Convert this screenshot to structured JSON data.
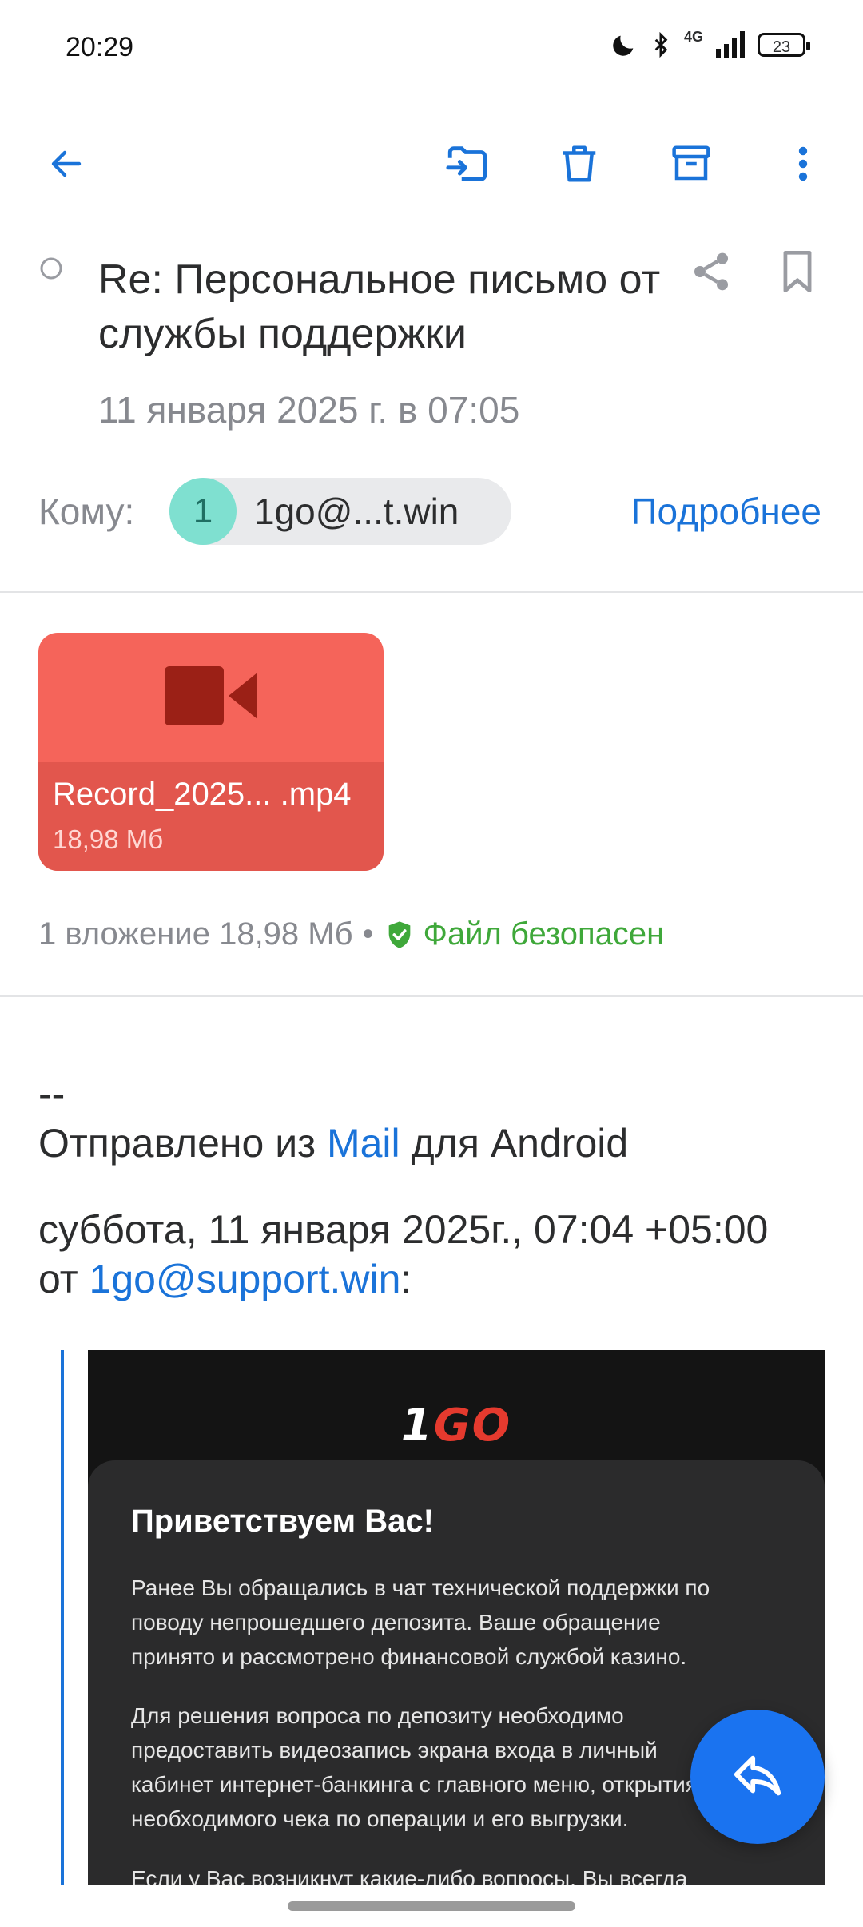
{
  "status_bar": {
    "time": "20:29",
    "battery": "23",
    "network": "4G"
  },
  "toolbar": {
    "back_icon": "arrow-left-icon",
    "move_icon": "folder-move-icon",
    "delete_icon": "trash-icon",
    "archive_icon": "archive-icon",
    "more_icon": "more-vertical-icon"
  },
  "email": {
    "subject": "Re: Персональное письмо от службы поддержки",
    "date": "11 января 2025 г. в 07:05",
    "to_label": "Кому:",
    "recipient_initial": "1",
    "recipient": "1go@...t.win",
    "details_link": "Подробнее"
  },
  "attachment": {
    "name": "Record_2025... .mp4",
    "size": "18,98 Мб",
    "summary": "1 вложение 18,98 Мб",
    "bullet": "•",
    "safe_label": "Файл безопасен"
  },
  "body": {
    "dashes": "--",
    "sent_from_prefix": "Отправлено из ",
    "sent_from_app": "Mail",
    "sent_from_suffix": " для Android",
    "quote_header_line1": "суббота, 11 января 2025г., 07:04 +05:00",
    "quote_header_from": "от ",
    "quote_header_email": "1go@support.win",
    "quote_header_colon": ":"
  },
  "quoted": {
    "logo_one": "1",
    "logo_go": "GO",
    "greeting": "Приветствуем Вас!",
    "p1": "Ранее Вы обращались в чат технической поддержки по поводу непрошедшего депозита. Ваше обращение принято и рассмотрено финансовой службой казино.",
    "p2": "Для решения вопроса по депозиту необходимо предоставить видеозапись экрана входа в личный кабинет интернет-банкинга с главного меню, открытия необходимого чека по операции и его выгрузки.",
    "p3": "Если у Вас возникнут какие-либо вопросы, Вы всегда можете обратиться в чат технической поддержки на нашем"
  },
  "colors": {
    "accent": "#1a73d9",
    "attachment": "#f5645a",
    "safe": "#3fa83a"
  }
}
